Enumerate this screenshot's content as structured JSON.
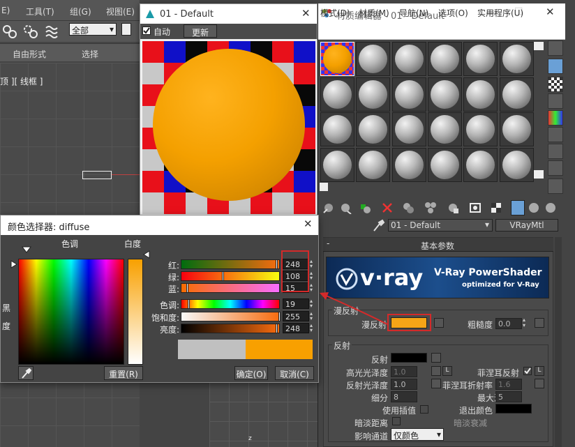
{
  "main": {
    "menu": [
      "E)",
      "工具(T)",
      "组(G)",
      "视图(E)"
    ],
    "selection_filter": "全部",
    "ribbon": [
      "自由形式",
      "选择"
    ],
    "viewport_label": "顶 ][ 线框 ]",
    "axis_label": "z"
  },
  "preview": {
    "title": "01 - Default",
    "auto_label": "自动",
    "update_label": "更新"
  },
  "mated": {
    "title": "材质编辑器 - 01 - Default",
    "menu": [
      "模式(D)",
      "材质(M)",
      "导航(N)",
      "选项(O)",
      "实用程序(U)"
    ],
    "material_name": "01 - Default",
    "material_type": "VRayMtl",
    "rollout_title": "基本参数",
    "vray_logo": "v·ray",
    "vray_banner": "V-Ray PowerShader",
    "vray_sub": "optimized for V-Ray",
    "diffuse_group": "漫反射",
    "diffuse_label": "漫反射",
    "diffuse_color": "#f5a517",
    "roughness_label": "粗糙度",
    "roughness_value": "0.0",
    "reflection_group": "反射",
    "reflect_label": "反射",
    "hilight_label": "高光光泽度",
    "hilight_value": "1.0",
    "fresnel_label": "菲涅耳反射",
    "lock_label": "L",
    "refl_gloss_label": "反射光泽度",
    "refl_gloss_value": "1.0",
    "fresnel_ior_label": "菲涅耳折射率",
    "fresnel_ior_value": "1.6",
    "subdivs_label": "细分",
    "subdivs_value": "8",
    "max_depth_label": "最大深度",
    "max_depth_value": "5",
    "interp_label": "使用插值",
    "exit_color_label": "退出颜色",
    "dim_dist_label": "暗淡距离",
    "dim_falloff_label": "暗淡衰减",
    "affect_label": "影响通道",
    "affect_value": "仅颜色"
  },
  "picker": {
    "title": "颜色选择器: diffuse",
    "hue_label": "色调",
    "white_label": "白度",
    "black_label": "黑",
    "deg_label": "度",
    "r_label": "红:",
    "g_label": "绿:",
    "b_label": "蓝:",
    "h_label": "色调:",
    "s_label": "饱和度:",
    "v_label": "亮度:",
    "r": "248",
    "g": "108",
    "b": "15",
    "h": "19",
    "s": "255",
    "v": "248",
    "reset_label": "重置(R)",
    "ok_label": "确定(O)",
    "cancel_label": "取消(C)",
    "old_color": "#c0c0c0",
    "new_color": "#f8a000"
  }
}
